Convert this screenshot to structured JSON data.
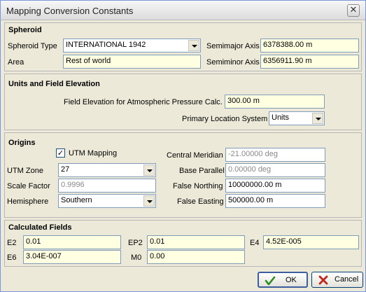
{
  "window": {
    "title": "Mapping Conversion Constants",
    "close_glyph": "✕"
  },
  "spheroid": {
    "heading": "Spheroid",
    "type_label": "Spheroid Type",
    "type_value": "INTERNATIONAL 1942",
    "area_label": "Area",
    "area_value": "Rest of world",
    "semimajor_label": "Semimajor Axis",
    "semimajor_value": "6378388.00 m",
    "semiminor_label": "Semiminor Axis",
    "semiminor_value": "6356911.90 m"
  },
  "units": {
    "heading": "Units and Field Elevation",
    "elevation_label": "Field Elevation for Atmospheric Pressure Calc.",
    "elevation_value": "300.00 m",
    "primary_label": "Primary Location System",
    "primary_value": "Units"
  },
  "origins": {
    "heading": "Origins",
    "utm_mapping_label": "UTM Mapping",
    "utm_mapping_checked": "✓",
    "utm_zone_label": "UTM Zone",
    "utm_zone_value": "27",
    "scale_factor_label": "Scale Factor",
    "scale_factor_value": "0.9996",
    "hemisphere_label": "Hemisphere",
    "hemisphere_value": "Southern",
    "central_meridian_label": "Central Meridian",
    "central_meridian_value": "-21.00000 deg",
    "base_parallel_label": "Base Parallel",
    "base_parallel_value": "0.00000 deg",
    "false_northing_label": "False Northing",
    "false_northing_value": "10000000.00 m",
    "false_easting_label": "False Easting",
    "false_easting_value": "500000.00 m"
  },
  "calculated": {
    "heading": "Calculated Fields",
    "e2_label": "E2",
    "e2_value": "0.01",
    "ep2_label": "EP2",
    "ep2_value": "0.01",
    "e4_label": "E4",
    "e4_value": "4.52E-005",
    "e6_label": "E6",
    "e6_value": "3.04E-007",
    "m0_label": "M0",
    "m0_value": "0.00"
  },
  "buttons": {
    "ok_label": "OK",
    "cancel_label": "Cancel"
  },
  "colors": {
    "ok_icon": "#2e8b22",
    "cancel_icon": "#c0281c"
  }
}
